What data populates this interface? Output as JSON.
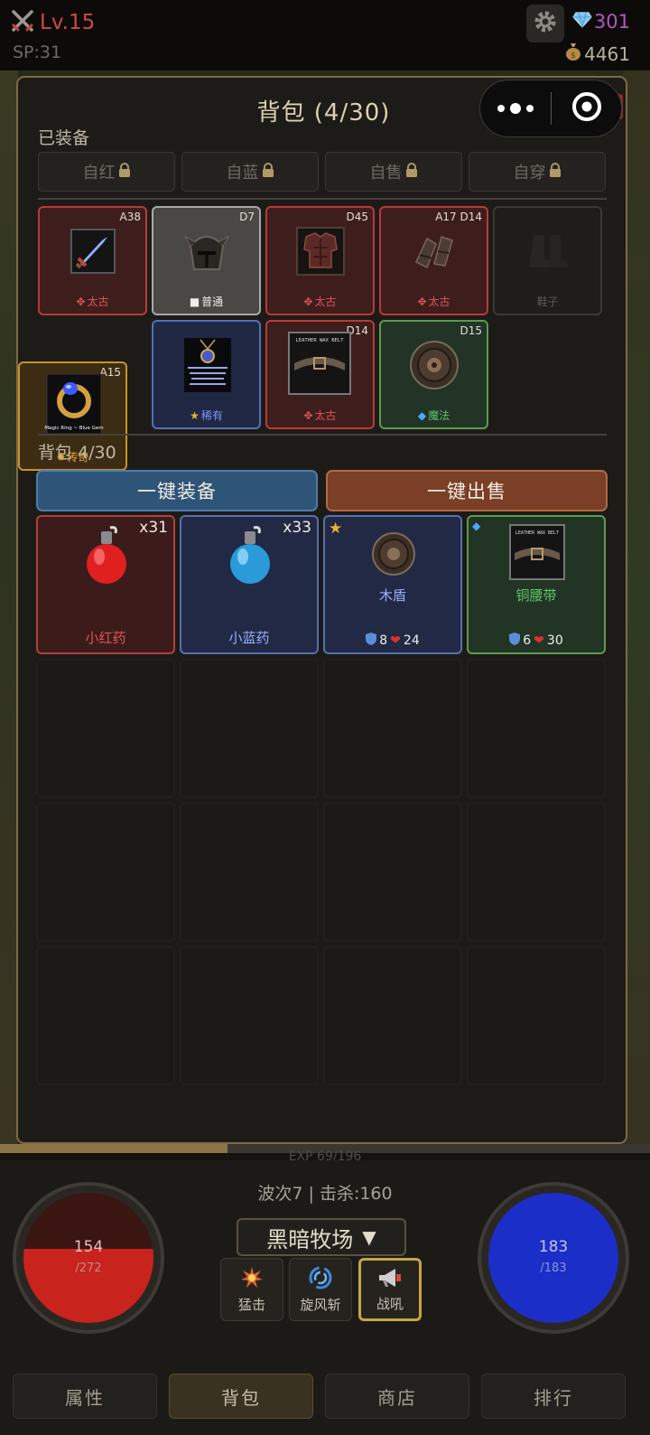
{
  "header": {
    "level": "Lv.15",
    "sp": "SP:31",
    "gems": "301",
    "gold": "4461"
  },
  "bag_panel": {
    "title": "背包 (4/30)",
    "equipped_label": "已装备",
    "locks": [
      "自红",
      "自蓝",
      "自售",
      "自穿"
    ],
    "equipped": [
      {
        "tag": "A38",
        "rarity": "太古",
        "tier": "red",
        "icon": "sword-icon"
      },
      {
        "tag": "D7",
        "rarity": "普通",
        "tier": "gray",
        "icon": "helmet-icon"
      },
      {
        "tag": "D45",
        "rarity": "太古",
        "tier": "red",
        "icon": "armor-icon"
      },
      {
        "tag": "A17 D14",
        "rarity": "太古",
        "tier": "red",
        "icon": "gloves-icon"
      },
      {
        "tag": "",
        "rarity": "鞋子",
        "tier": "empty",
        "icon": "boots-icon"
      },
      {
        "tag": "A15",
        "rarity": "传奇",
        "tier": "gold",
        "icon": "ring-icon"
      },
      {
        "tag": "",
        "rarity": "稀有",
        "tier": "blue",
        "icon": "amulet-icon"
      },
      {
        "tag": "D14",
        "rarity": "太古",
        "tier": "red",
        "icon": "belt-icon"
      },
      {
        "tag": "D15",
        "rarity": "魔法",
        "tier": "green",
        "icon": "shield-icon"
      }
    ],
    "backpack_label": "背包 4/30",
    "equip_all": "一键装备",
    "sell_all": "一键出售",
    "items": [
      {
        "name": "小红药",
        "qty": "x31",
        "tier": "red",
        "icon": "red-potion-icon"
      },
      {
        "name": "小蓝药",
        "qty": "x33",
        "tier": "blue",
        "icon": "blue-potion-icon"
      },
      {
        "name": "木盾",
        "def": "8",
        "hp": "24",
        "tier": "blue",
        "mark": "star",
        "icon": "round-shield-icon"
      },
      {
        "name": "铜腰带",
        "def": "6",
        "hp": "30",
        "tier": "green",
        "mark": "diamond",
        "icon": "leather-belt-icon"
      }
    ]
  },
  "bottom": {
    "exp_text": "EXP 69/196",
    "exp_progress": 0.35,
    "hp_current": "154",
    "hp_max": "/272",
    "hp_fraction": 0.57,
    "mp_current": "183",
    "mp_max": "/183",
    "wave": "波次7 | 击杀:160",
    "map": "黑暗牧场",
    "skills": [
      "猛击",
      "旋风斩",
      "战吼"
    ],
    "active_skill": "战吼"
  },
  "nav": [
    "属性",
    "背包",
    "商店",
    "排行"
  ],
  "colors": {
    "legendary": "#e8a830",
    "rare": "#7a96ff",
    "magic": "#62c26a",
    "ancient": "#e05454",
    "hp": "#c8231c",
    "mp": "#1c2ec8"
  }
}
